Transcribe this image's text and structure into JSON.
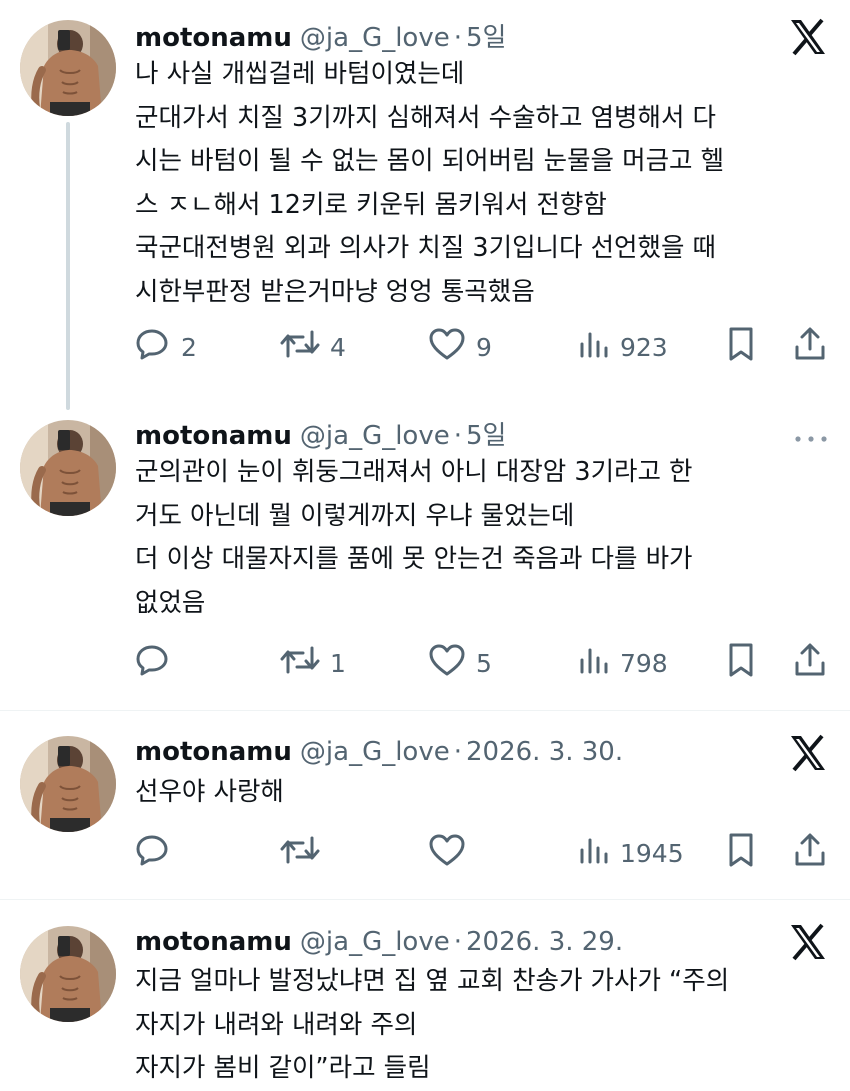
{
  "tweets": [
    {
      "name": "motonamu",
      "handle": "@ja_G_love",
      "separator": "·",
      "date": "5일",
      "lines": [
        "나 사실 개씹걸레 바텀이였는데",
        "군대가서 치질 3기까지 심해져서 수술하고 염병해서 다",
        "시는 바텀이 될 수 없는 몸이 되어버림 눈물을 머금고 헬",
        "스 ㅈㄴ해서 12키로 키운뒤 몸키워서 전향함",
        "국군대전병원 외과 의사가 치질 3기입니다 선언했을 때",
        "시한부판정 받은거마냥 엉엉 통곡했음"
      ],
      "replies": "2",
      "reposts": "4",
      "likes": "9",
      "views": "923",
      "corner_icon": "x-logo"
    },
    {
      "name": "motonamu",
      "handle": "@ja_G_love",
      "separator": "·",
      "date": "5일",
      "lines": [
        "군의관이 눈이 휘둥그래져서 아니 대장암 3기라고 한",
        "거도 아닌데 뭘 이렇게까지 우냐 물었는데",
        "더 이상 대물자지를 품에 못 안는건 죽음과 다를 바가",
        "없었음"
      ],
      "replies": "",
      "reposts": "1",
      "likes": "5",
      "views": "798",
      "corner_icon": "more-icon"
    },
    {
      "name": "motonamu",
      "handle": "@ja_G_love",
      "separator": "·",
      "date": "2026. 3. 30.",
      "lines": [
        "선우야 사랑해"
      ],
      "replies": "",
      "reposts": "",
      "likes": "",
      "views": "1945",
      "corner_icon": "x-logo"
    },
    {
      "name": "motonamu",
      "handle": "@ja_G_love",
      "separator": "·",
      "date": "2026. 3. 29.",
      "lines": [
        "지금 얼마나 발정났냐면 집 옆 교회 찬송가 가사가 “주의",
        "자지가 내려와 내려와 주의",
        "자지가 봄비 같이”라고 들림"
      ],
      "corner_icon": "x-logo"
    }
  ],
  "colors": {
    "text": "#0f1419",
    "secondary": "#536471",
    "divider": "#eff3f4",
    "thread_line": "#cfd9de"
  }
}
